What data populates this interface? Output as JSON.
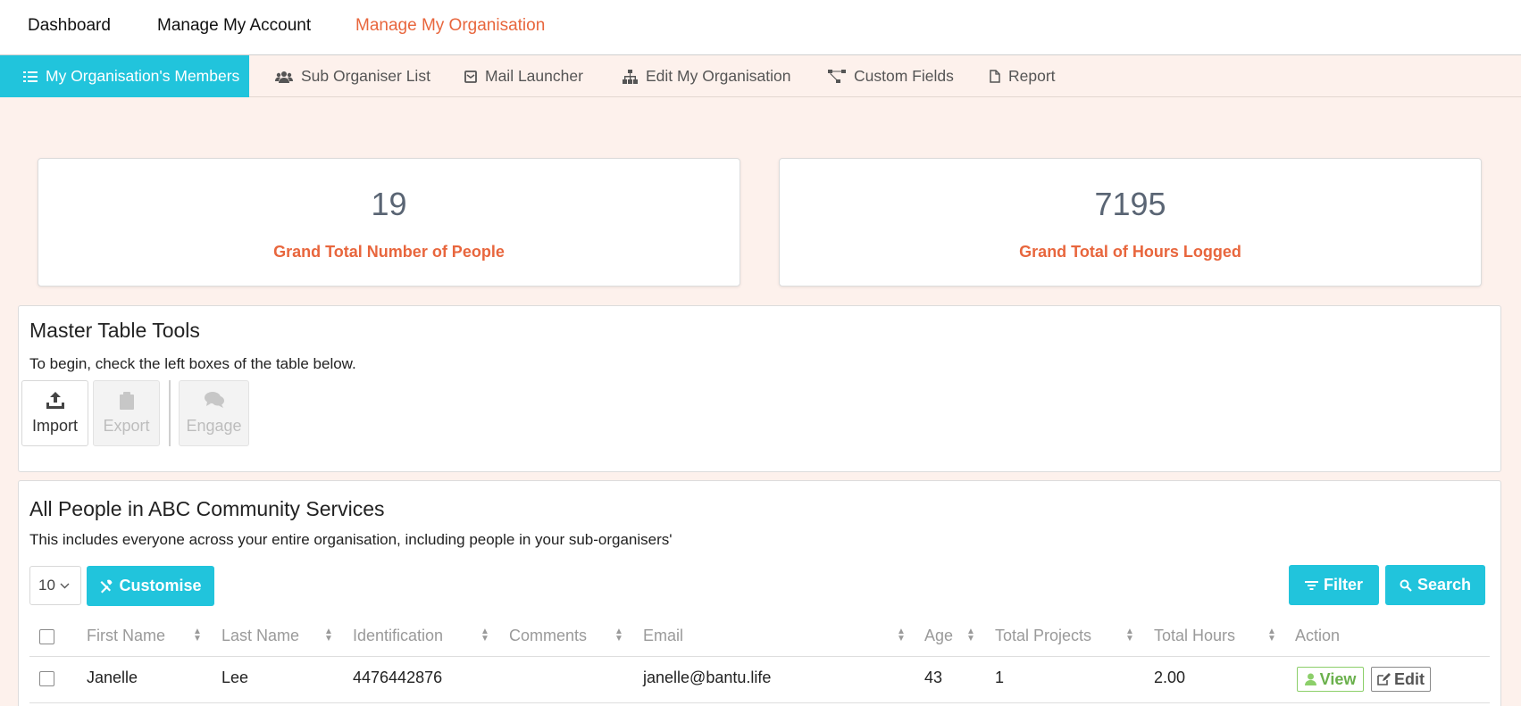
{
  "topnav": {
    "items": [
      {
        "label": "Dashboard"
      },
      {
        "label": "Manage My Account"
      },
      {
        "label": "Manage My Organisation"
      }
    ]
  },
  "subnav": {
    "tabs": [
      {
        "label": "My Organisation's Members",
        "icon": "list-icon"
      },
      {
        "label": "Sub Organiser List",
        "icon": "users-icon"
      },
      {
        "label": "Mail Launcher",
        "icon": "mail-icon"
      },
      {
        "label": "Edit My Organisation",
        "icon": "sitemap-icon"
      },
      {
        "label": "Custom Fields",
        "icon": "fields-icon"
      },
      {
        "label": "Report",
        "icon": "file-icon"
      }
    ]
  },
  "stats": [
    {
      "value": "19",
      "label": "Grand Total Number of People"
    },
    {
      "value": "7195",
      "label": "Grand Total of Hours Logged"
    }
  ],
  "master_tools": {
    "title": "Master Table Tools",
    "subtitle": "To begin, check the left boxes of the table below.",
    "buttons": [
      {
        "label": "Import",
        "icon": "upload-icon"
      },
      {
        "label": "Export",
        "icon": "clipboard-icon"
      },
      {
        "label": "Engage",
        "icon": "comments-icon"
      }
    ]
  },
  "people": {
    "title": "All People in ABC Community Services",
    "subtitle": "This includes everyone across your entire organisation, including people in your sub-organisers'",
    "page_size": "10",
    "customise_label": "Customise",
    "filter_label": "Filter",
    "search_label": "Search",
    "columns": [
      "First Name",
      "Last Name",
      "Identification",
      "Comments",
      "Email",
      "Age",
      "Total Projects",
      "Total Hours",
      "Action"
    ],
    "rows": [
      {
        "first_name": "Janelle",
        "last_name": "Lee",
        "identification": "4476442876",
        "comments": "",
        "email": "janelle@bantu.life",
        "age": "43",
        "total_projects": "1",
        "total_hours": "2.00",
        "view_label": "View",
        "edit_label": "Edit"
      }
    ]
  },
  "colors": {
    "accent": "#21c4dc",
    "brand_orange": "#e8663d",
    "page_bg": "#fdf1ec",
    "view_green": "#6ab04c"
  }
}
